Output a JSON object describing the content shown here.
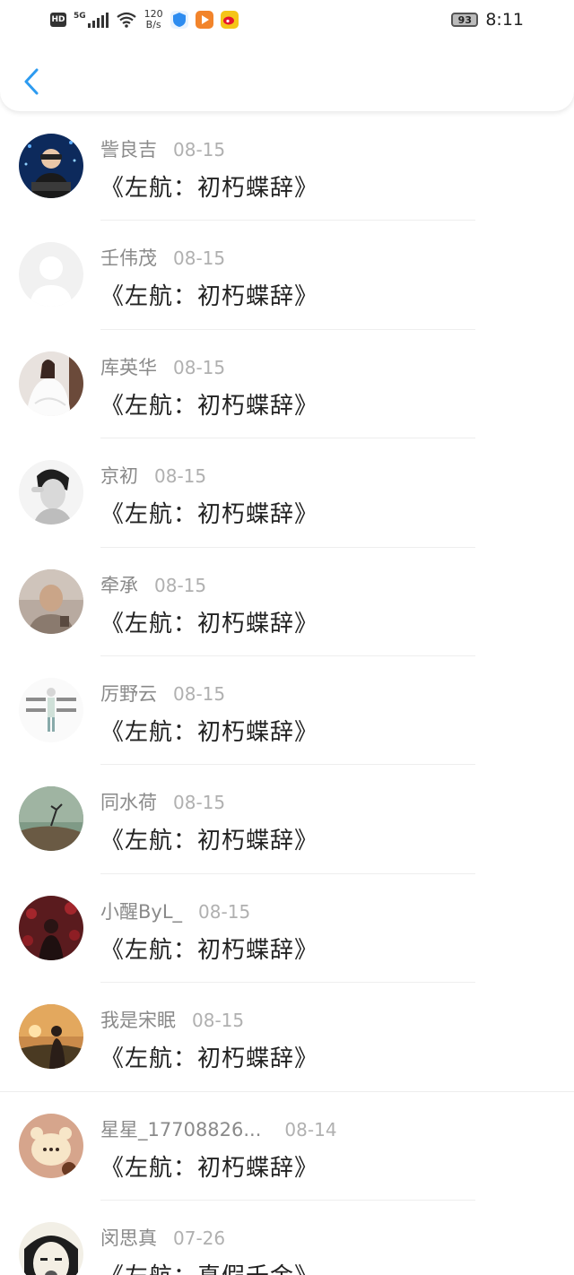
{
  "status_bar": {
    "hd": "HD",
    "signal": "5G",
    "speed_value": "120",
    "speed_unit": "B/s",
    "battery": "93",
    "time": "8:11"
  },
  "header": {
    "back_icon": "chevron-left-icon",
    "accent_color": "#2d9bf0"
  },
  "comments": [
    {
      "name": "訾良吉",
      "date": "08-15",
      "title": "《左航：初朽蝶辞》"
    },
    {
      "name": "壬伟茂",
      "date": "08-15",
      "title": "《左航：初朽蝶辞》"
    },
    {
      "name": "库英华",
      "date": "08-15",
      "title": "《左航：初朽蝶辞》"
    },
    {
      "name": "京初",
      "date": "08-15",
      "title": "《左航：初朽蝶辞》"
    },
    {
      "name": "牵承",
      "date": "08-15",
      "title": "《左航：初朽蝶辞》"
    },
    {
      "name": "厉野云",
      "date": "08-15",
      "title": "《左航：初朽蝶辞》"
    },
    {
      "name": "同水荷",
      "date": "08-15",
      "title": "《左航：初朽蝶辞》"
    },
    {
      "name": "小醒ByL_",
      "date": "08-15",
      "title": "《左航：初朽蝶辞》"
    },
    {
      "name": "我是宋眠",
      "date": "08-15",
      "title": "《左航：初朽蝶辞》"
    },
    {
      "name": "星星_17708826...",
      "date": "08-14",
      "title": "《左航：初朽蝶辞》"
    },
    {
      "name": "闵思真",
      "date": "07-26",
      "title": "《左航：真假千金》"
    }
  ]
}
